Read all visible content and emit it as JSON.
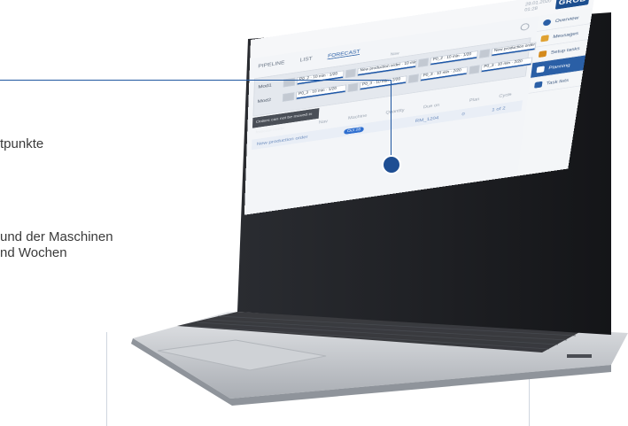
{
  "background_text": {
    "line1": "tpunkte",
    "line2": "und der Maschinen",
    "line3": "nd Wochen"
  },
  "colors": {
    "accent": "#1e56a0",
    "brand": "#1c4e8f",
    "laptop_body": "#c9ccd1",
    "bezel": "#1b1d21"
  },
  "app": {
    "logo": "GROB",
    "date": "29.01.2020",
    "time": "01:28",
    "tabs": [
      {
        "label": "PIPELINE",
        "active": false
      },
      {
        "label": "LIST",
        "active": false
      },
      {
        "label": "FORECAST",
        "active": true
      }
    ],
    "sidebar": [
      {
        "label": "Overview",
        "icon": "gear-icon",
        "active": false
      },
      {
        "label": "Messages",
        "icon": "warning-icon",
        "active": false
      },
      {
        "label": "Setup tasks",
        "icon": "tools-icon",
        "active": false
      },
      {
        "label": "Planning",
        "icon": "calendar-icon",
        "active": true
      },
      {
        "label": "Task lists",
        "icon": "list-icon",
        "active": false
      }
    ],
    "gantt": {
      "time_label": "Now",
      "rows": [
        {
          "label": "Mod1",
          "jobs": [
            "P0_2 · 10 min · 1/20",
            "New production order · 10 min · 1/20",
            "P0_2 · 10 min · 1/20",
            "New production order · 10 min · 2/20"
          ]
        },
        {
          "label": "Mod2",
          "jobs": [
            "P0_3 · 10 min · 1/20",
            "P0_3 · 10 min · 2/20",
            "P0_3 · 10 min · 2/20",
            "P0_3 · 10 min · 2/20"
          ]
        }
      ]
    },
    "toast": "Orders can not be moved in forecast mode",
    "table": {
      "headers": [
        "",
        "Nav",
        "Machine",
        "Quantity",
        "Due on",
        "Plan",
        "Cycle"
      ],
      "row": [
        "New production order",
        "Oct 28",
        "RM_1204",
        "0",
        "1 of 2"
      ]
    }
  }
}
